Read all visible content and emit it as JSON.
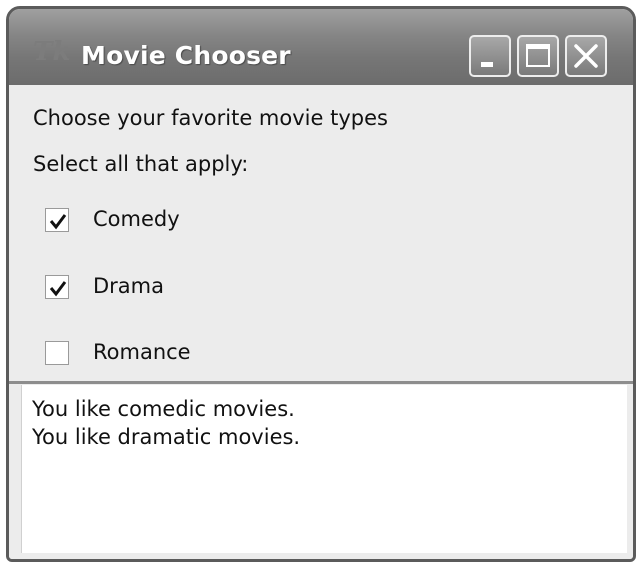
{
  "window": {
    "title": "Movie Chooser",
    "app_icon": "tk-icon"
  },
  "titlebar_buttons": [
    {
      "name": "minimize",
      "icon": "minimize-icon"
    },
    {
      "name": "maximize",
      "icon": "maximize-icon"
    },
    {
      "name": "close",
      "icon": "close-icon"
    }
  ],
  "prompt": {
    "line1": "Choose your favorite movie types",
    "line2": "Select all that apply:"
  },
  "options": [
    {
      "label": "Comedy",
      "checked": true
    },
    {
      "label": "Drama",
      "checked": true
    },
    {
      "label": "Romance",
      "checked": false
    }
  ],
  "output": {
    "lines": [
      "You like comedic movies.",
      "You like dramatic movies."
    ]
  },
  "colors": {
    "titlebar": "#7a7a7a",
    "window_bg": "#ececec",
    "output_bg": "#ffffff"
  }
}
